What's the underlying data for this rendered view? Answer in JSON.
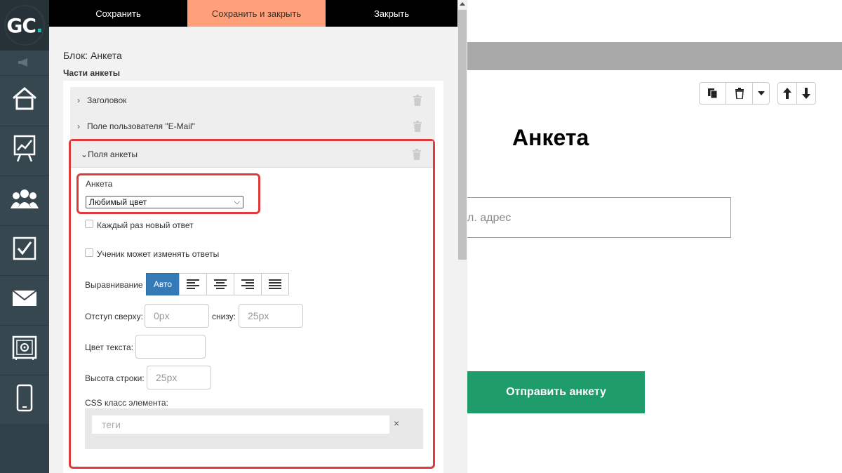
{
  "app": {
    "logo_text": "GC",
    "logo_dot": ".",
    "accent": "#1fc0b8"
  },
  "sidebar": {
    "items": [
      {
        "icon": "home-icon"
      },
      {
        "icon": "chart-board-icon"
      },
      {
        "icon": "users-icon"
      },
      {
        "icon": "checkbox-icon"
      },
      {
        "icon": "mail-icon"
      },
      {
        "icon": "safe-icon"
      },
      {
        "icon": "mobile-icon"
      }
    ]
  },
  "toolbar": {
    "save_label": "Сохранить",
    "save_close_label": "Сохранить и закрыть",
    "close_label": "Закрыть"
  },
  "editor": {
    "block_title": "Блок: Анкета",
    "parts_title": "Части анкеты",
    "parts": [
      {
        "label": "Заголовок"
      },
      {
        "label": "Поле пользователя \"E-Mail\""
      },
      {
        "label": "Поля анкеты"
      }
    ],
    "fields": {
      "anketa_label": "Анкета",
      "anketa_value": "Любимый цвет",
      "new_answer_label": "Каждый раз новый ответ",
      "student_edit_label": "Ученик может изменять ответы",
      "align_label": "Выравнивание",
      "align_auto": "Авто",
      "margin_top_label": "Отступ сверху:",
      "margin_top_placeholder": "0px",
      "margin_bottom_label": "снизу:",
      "margin_bottom_placeholder": "25px",
      "text_color_label": "Цвет текста:",
      "line_height_label": "Высота строки:",
      "line_height_placeholder": "25px",
      "css_class_label": "CSS класс элемента:",
      "tags_placeholder": "теги",
      "tags_clear": "×"
    }
  },
  "preview": {
    "title": "Анкета",
    "email_placeholder": "л. адрес",
    "submit_label": "Отправить анкету",
    "submit_color": "#1e9c6a"
  }
}
